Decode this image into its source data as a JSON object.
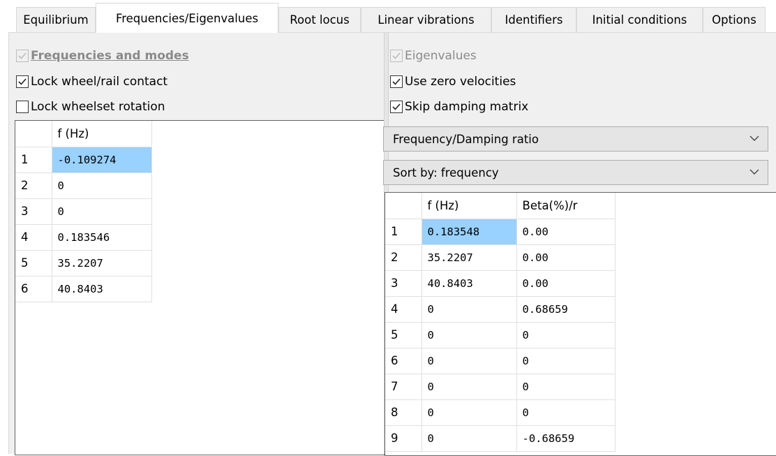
{
  "tabs": [
    {
      "label": "Equilibrium",
      "active": false
    },
    {
      "label": "Frequencies/Eigenvalues",
      "active": true
    },
    {
      "label": "Root locus",
      "active": false
    },
    {
      "label": "Linear vibrations",
      "active": false
    },
    {
      "label": "Identifiers",
      "active": false
    },
    {
      "label": "Initial conditions",
      "active": false
    },
    {
      "label": "Options",
      "active": false
    }
  ],
  "left": {
    "frequencies_modes": {
      "label": "Frequencies and modes",
      "checked": true,
      "enabled": false
    },
    "lock_contact": {
      "label": "Lock wheel/rail contact",
      "checked": true
    },
    "lock_rotation": {
      "label": "Lock wheelset rotation",
      "checked": false
    },
    "grid": {
      "header": "f (Hz)",
      "rows": [
        {
          "index": "1",
          "value": "-0.109274"
        },
        {
          "index": "2",
          "value": "0"
        },
        {
          "index": "3",
          "value": "0"
        },
        {
          "index": "4",
          "value": "0.183546"
        },
        {
          "index": "5",
          "value": "35.2207"
        },
        {
          "index": "6",
          "value": "40.8403"
        }
      ]
    }
  },
  "right": {
    "eigenvalues": {
      "label": "Eigenvalues",
      "checked": true,
      "enabled": false
    },
    "zero_velocities": {
      "label": "Use zero velocities",
      "checked": true
    },
    "skip_damping": {
      "label": "Skip damping matrix",
      "checked": true
    },
    "display_mode": {
      "selected": "Frequency/Damping ratio"
    },
    "sort_by": {
      "selected": "Sort by: frequency"
    },
    "grid": {
      "headers": [
        "f (Hz)",
        "Beta(%)/r"
      ],
      "rows": [
        {
          "index": "1",
          "f": "0.183548",
          "beta": "0.00"
        },
        {
          "index": "2",
          "f": "35.2207",
          "beta": "0.00"
        },
        {
          "index": "3",
          "f": "40.8403",
          "beta": "0.00"
        },
        {
          "index": "4",
          "f": "0",
          "beta": "0.68659"
        },
        {
          "index": "5",
          "f": "0",
          "beta": "0"
        },
        {
          "index": "6",
          "f": "0",
          "beta": "0"
        },
        {
          "index": "7",
          "f": "0",
          "beta": "0"
        },
        {
          "index": "8",
          "f": "0",
          "beta": "0"
        },
        {
          "index": "9",
          "f": "0",
          "beta": "-0.68659"
        }
      ]
    }
  }
}
